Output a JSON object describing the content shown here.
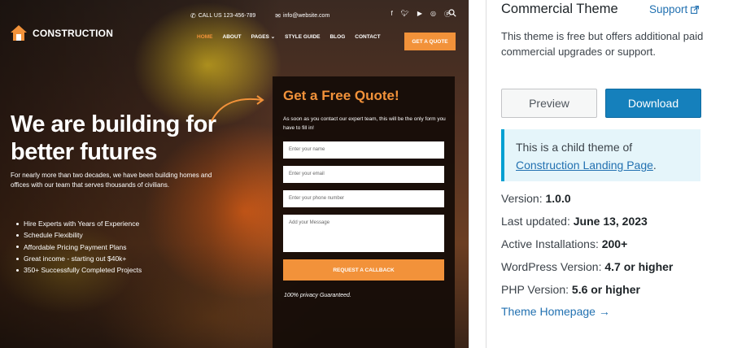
{
  "screenshot": {
    "topbar": {
      "phone": "CALL US 123-456-789",
      "email": "info@website.com"
    },
    "social_icons": [
      "facebook-icon",
      "twitter-icon",
      "youtube-icon",
      "instagram-icon",
      "pinterest-icon"
    ],
    "logo": {
      "text": "CONSTRUCTION"
    },
    "nav": {
      "items": [
        {
          "label": "HOME",
          "active": true
        },
        {
          "label": "ABOUT"
        },
        {
          "label": "PAGES ⌄"
        },
        {
          "label": "STYLE GUIDE"
        },
        {
          "label": "BLOG"
        },
        {
          "label": "CONTACT"
        }
      ],
      "cta": "GET A QUOTE"
    },
    "hero": {
      "title": "We are building for better futures",
      "description": "For nearly more than two decades, we have been building homes and offices with our team that serves thousands of civilians.",
      "bullets": [
        "Hire Experts with Years of Experience",
        "Schedule Flexibility",
        "Affordable Pricing Payment Plans",
        "Great income - starting out $40k+",
        "350+ Successfully Completed Projects"
      ]
    },
    "quote_form": {
      "title": "Get a Free Quote!",
      "subtitle": "As soon as you contact our expert team, this will be the only form you have to fill in!",
      "name_placeholder": "Enter your name",
      "email_placeholder": "Enter your email",
      "phone_placeholder": "Enter your phone number",
      "message_placeholder": "Add your Message",
      "button": "REQUEST A CALLBACK",
      "privacy": "100% privacy Guaranteed."
    },
    "colors": {
      "accent": "#f2923a",
      "panel": "#140c08"
    }
  },
  "info": {
    "title": "Commercial Theme",
    "support_label": "Support",
    "commercial_text": "This theme is free but offers additional paid commercial upgrades or support.",
    "preview_label": "Preview",
    "download_label": "Download",
    "child_notice": {
      "prefix": "This is a child theme of",
      "parent_link": "Construction Landing Page",
      "suffix": "."
    },
    "meta": [
      {
        "label": "Version:",
        "value": "1.0.0"
      },
      {
        "label": "Last updated:",
        "value": "June 13, 2023"
      },
      {
        "label": "Active Installations:",
        "value": "200+"
      },
      {
        "label": "WordPress Version:",
        "value": "4.7 or higher"
      },
      {
        "label": "PHP Version:",
        "value": "5.6 or higher"
      }
    ],
    "homepage_label": "Theme Homepage →",
    "colors": {
      "link": "#2271b1",
      "download_bg": "#1580bc",
      "notice_border": "#00a0d2"
    }
  }
}
